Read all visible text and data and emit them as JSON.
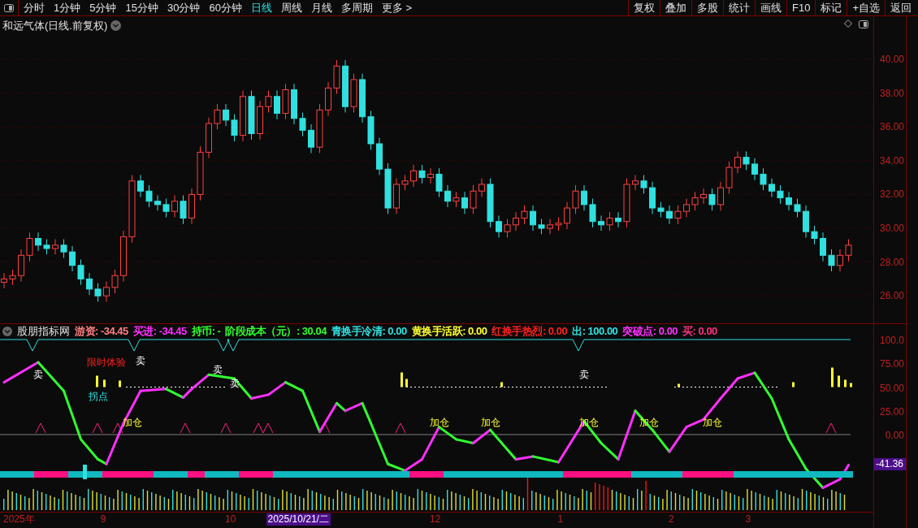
{
  "toolbar": {
    "tabs": [
      {
        "label": "分时",
        "selected": false
      },
      {
        "label": "1分钟",
        "selected": false
      },
      {
        "label": "5分钟",
        "selected": false
      },
      {
        "label": "15分钟",
        "selected": false
      },
      {
        "label": "30分钟",
        "selected": false
      },
      {
        "label": "60分钟",
        "selected": false
      },
      {
        "label": "日线",
        "selected": true
      },
      {
        "label": "周线",
        "selected": false
      },
      {
        "label": "月线",
        "selected": false
      },
      {
        "label": "多周期",
        "selected": false
      },
      {
        "label": "更多 >",
        "selected": false
      }
    ],
    "buttons": [
      "复权",
      "叠加",
      "多股",
      "统计",
      "画线",
      "F10",
      "标记",
      "+自选",
      "返回"
    ]
  },
  "price_chart": {
    "title": "和远气体(日线.前复权)",
    "yticks": [
      "40.00",
      "38.00",
      "36.00",
      "34.00",
      "32.00",
      "30.00",
      "28.00",
      "26.00"
    ]
  },
  "indicator": {
    "name": "股朋指标网",
    "readings": [
      {
        "text": "游资: -34.45",
        "color": "#ff8080"
      },
      {
        "text": "买进: -34.45",
        "color": "#ff30ff"
      },
      {
        "text": "持币: -",
        "color": "#30ff30"
      },
      {
        "text": "阶段成本（元）: 30.04",
        "color": "#30ff30"
      },
      {
        "text": "青换手冷清: 0.00",
        "color": "#30e0e0"
      },
      {
        "text": "黄换手活跃: 0.00",
        "color": "#ffff30"
      },
      {
        "text": "红换手热烈: 0.00",
        "color": "#ff2020"
      },
      {
        "text": "出: 100.00",
        "color": "#30e0e0"
      },
      {
        "text": "突破点: 0.00",
        "color": "#ff30ff"
      },
      {
        "text": "买: 0.00",
        "color": "#ff3080"
      }
    ],
    "yticks": [
      "100.0",
      "75.00",
      "50.00",
      "25.00",
      "0.00"
    ],
    "current_value": "-41.36",
    "annotations": [
      {
        "kind": "sell",
        "text": "卖"
      },
      {
        "kind": "trial",
        "text": "限时体验"
      },
      {
        "kind": "sell",
        "text": "卖"
      },
      {
        "kind": "turn",
        "text": "拐点"
      },
      {
        "kind": "add",
        "text": "加仓"
      },
      {
        "kind": "sell",
        "text": "卖"
      },
      {
        "kind": "sell",
        "text": "卖"
      },
      {
        "kind": "add",
        "text": "加仓"
      },
      {
        "kind": "add",
        "text": "加仓"
      },
      {
        "kind": "add",
        "text": "加仓"
      },
      {
        "kind": "sell",
        "text": "卖"
      },
      {
        "kind": "add",
        "text": "加仓"
      },
      {
        "kind": "add",
        "text": "加仓"
      }
    ]
  },
  "date_axis": [
    {
      "text": "2025年",
      "selected": false
    },
    {
      "text": "9",
      "selected": false
    },
    {
      "text": "10",
      "selected": false
    },
    {
      "text": "2025/10/21/二",
      "selected": true
    },
    {
      "text": "12",
      "selected": false
    },
    {
      "text": "1",
      "selected": false
    },
    {
      "text": "2",
      "selected": false
    },
    {
      "text": "3",
      "selected": false
    }
  ]
}
